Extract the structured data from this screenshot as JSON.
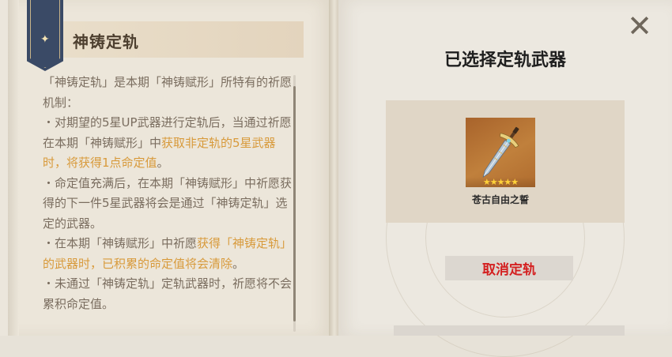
{
  "left_page": {
    "title": "神铸定轨",
    "paragraphs": [
      [
        {
          "t": "「神铸定轨」是本期「神铸赋形」所特有的祈愿机制：",
          "hl": false
        }
      ],
      [
        {
          "t": "・对期望的5星UP武器进行定轨后，当通过祈愿在本期「神铸赋形」中",
          "hl": false
        },
        {
          "t": "获取非定轨的5星武器时，将获得1点命定值",
          "hl": true
        },
        {
          "t": "。",
          "hl": false
        }
      ],
      [
        {
          "t": "・命定值充满后，在本期「神铸赋形」中祈愿获得的下一件5星武器将会是通过「神铸定轨」选定的武器。",
          "hl": false
        }
      ],
      [
        {
          "t": "・在本期「神铸赋形」中祈愿",
          "hl": false
        },
        {
          "t": "获得「神铸定轨」的武器时，已积累的命定值将会清除",
          "hl": true
        },
        {
          "t": "。",
          "hl": false
        }
      ],
      [
        {
          "t": "・未通过「神铸定轨」定轨武器时，祈愿将不会累积命定值。",
          "hl": false
        }
      ]
    ]
  },
  "right_page": {
    "title": "已选择定轨武器",
    "weapon": {
      "name": "苍古自由之誓",
      "rarity": 5,
      "stars": "★★★★★",
      "icon": "sword-icon"
    },
    "cancel_label": "取消定轨"
  },
  "close_icon": "✕",
  "colors": {
    "highlight": "#d89a3b",
    "cancel_text": "#d42020",
    "bookmark": "#3a4a66",
    "body_text": "#7a6d5f"
  }
}
